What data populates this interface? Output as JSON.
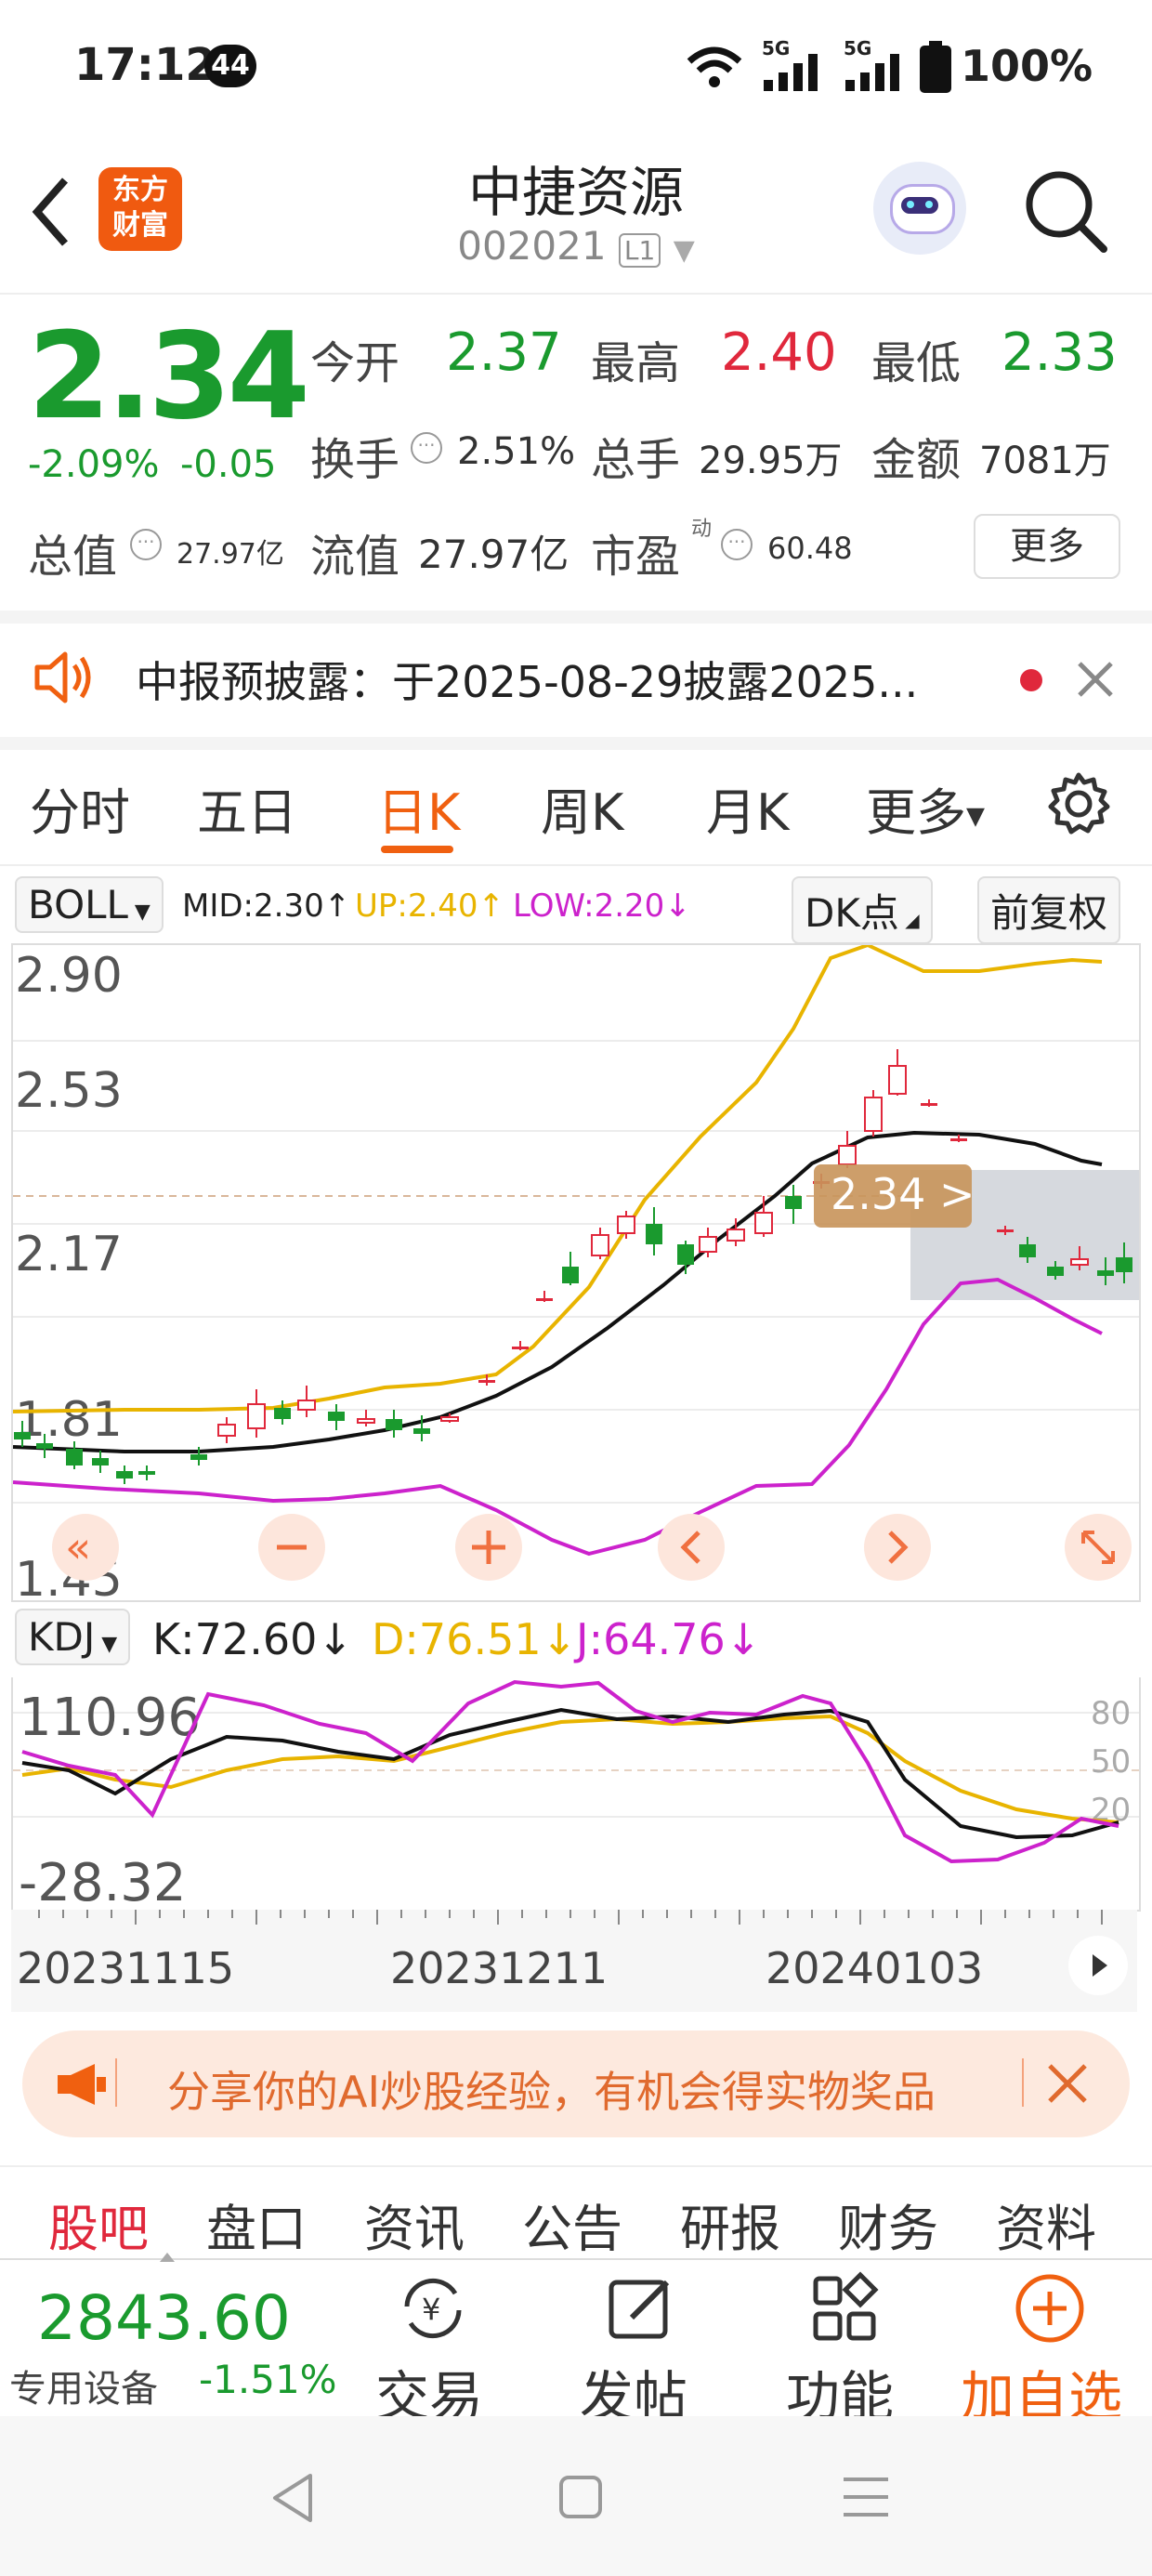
{
  "status": {
    "time": "17:12",
    "badge": "44",
    "net1": "5G",
    "net2": "5G",
    "battery": "100%"
  },
  "header": {
    "brand_line1": "东方",
    "brand_line2": "财富",
    "title": "中捷资源",
    "code": "002021",
    "level": "L1"
  },
  "quote": {
    "price": "2.34",
    "change_pct": "-2.09%",
    "change": "-0.05",
    "open_label": "今开",
    "open": "2.37",
    "high_label": "最高",
    "high": "2.40",
    "low_label": "最低",
    "low": "2.33",
    "turnover_label": "换手",
    "turnover": "2.51%",
    "volume_label": "总手",
    "volume": "29.95万",
    "amount_label": "金额",
    "amount": "7081万",
    "mktcap_label": "总值",
    "mktcap": "27.97亿",
    "float_label": "流值",
    "float": "27.97亿",
    "pe_label": "市盈",
    "pe_sup": "动",
    "pe": "60.48",
    "more_label": "更多"
  },
  "notice": {
    "text": "中报预披露：于2025-08-29披露2025..."
  },
  "tabs": [
    "分时",
    "五日",
    "日K",
    "周K",
    "月K",
    "更多"
  ],
  "active_tab": 2,
  "boll": {
    "name": "BOLL",
    "mid": "MID:2.30↑",
    "up": "UP:2.40↑",
    "low": "LOW:2.20↓",
    "dk": "DK点",
    "adjust": "前复权"
  },
  "chart": {
    "y_labels": [
      "2.90",
      "2.53",
      "2.17",
      "1.81",
      "1.45"
    ],
    "price_tag": "2.34 >",
    "ylim": [
      1.45,
      2.9
    ]
  },
  "kdj": {
    "name": "KDJ",
    "k": "K:72.60↓",
    "d": "D:76.51↓",
    "j": "J:64.76↓",
    "y_top": "110.96",
    "y_bottom": "-28.32",
    "levels": [
      "80",
      "50",
      "20"
    ]
  },
  "axis": {
    "dates": [
      "20231115",
      "20231211",
      "20240103"
    ]
  },
  "banner": {
    "text": "分享你的AI炒股经验，有机会得实物奖品"
  },
  "subtabs": [
    "股吧",
    "盘口",
    "资讯",
    "公告",
    "研报",
    "财务",
    "资料"
  ],
  "bottom": {
    "index_value": "2843.60",
    "index_name": "专用设备",
    "index_change": "-1.51%",
    "trade": "交易",
    "post": "发帖",
    "func": "功能",
    "watch": "加自选"
  },
  "colors": {
    "up": "#e0283c",
    "down": "#1a9a2e",
    "accent": "#f06010",
    "mid": "#111111",
    "upper": "#e8b400",
    "lower": "#cc22cc"
  }
}
